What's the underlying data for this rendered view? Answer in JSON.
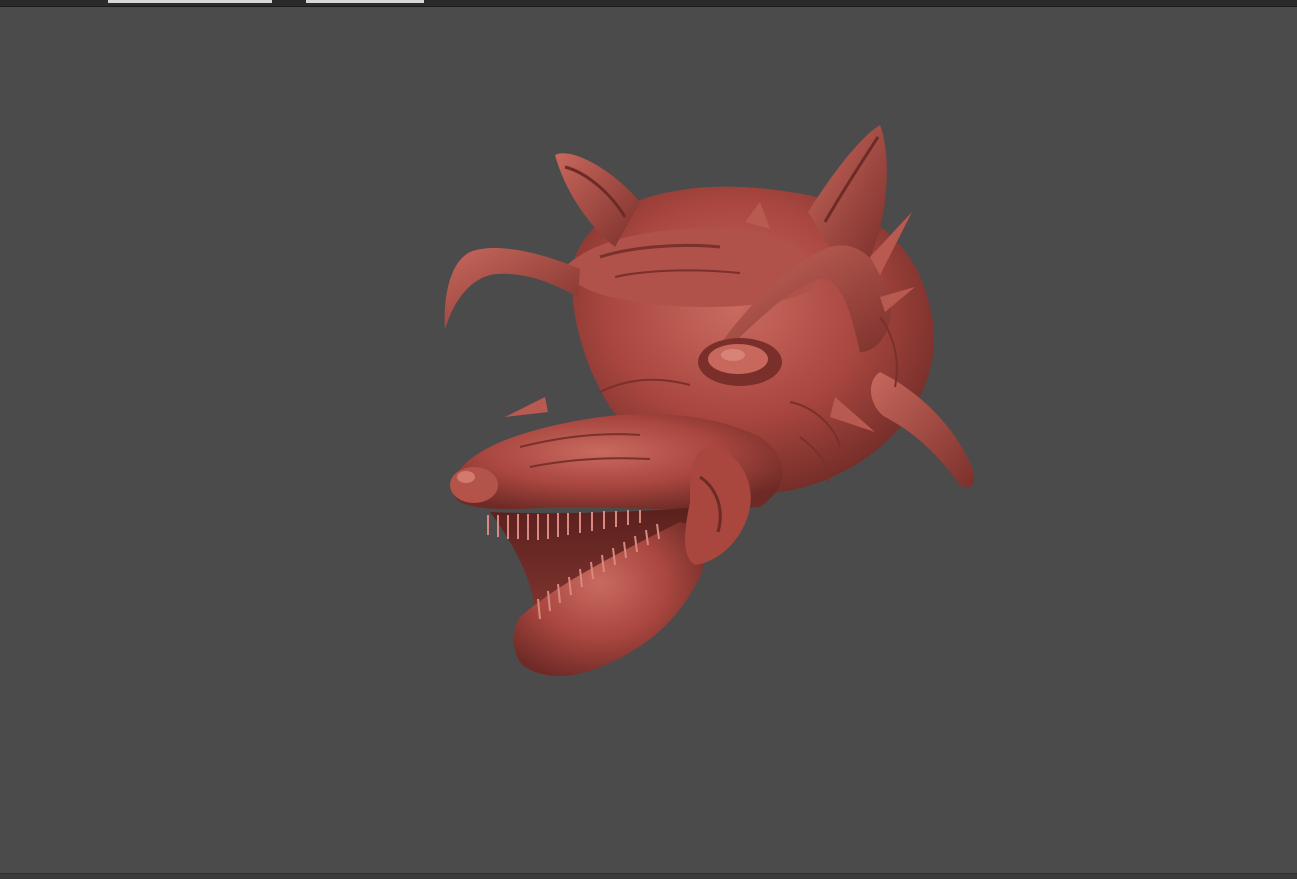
{
  "app": {
    "window": "3d-sculpt-viewport"
  },
  "viewport": {
    "background": "#4b4b4b",
    "model": {
      "name": "wolf-demon-head-sculpt",
      "material_color": "#a8463f",
      "highlight_color": "#c9665c",
      "shadow_color": "#6e2a26"
    }
  },
  "icons": {
    "model": "sculpt-model-icon"
  }
}
